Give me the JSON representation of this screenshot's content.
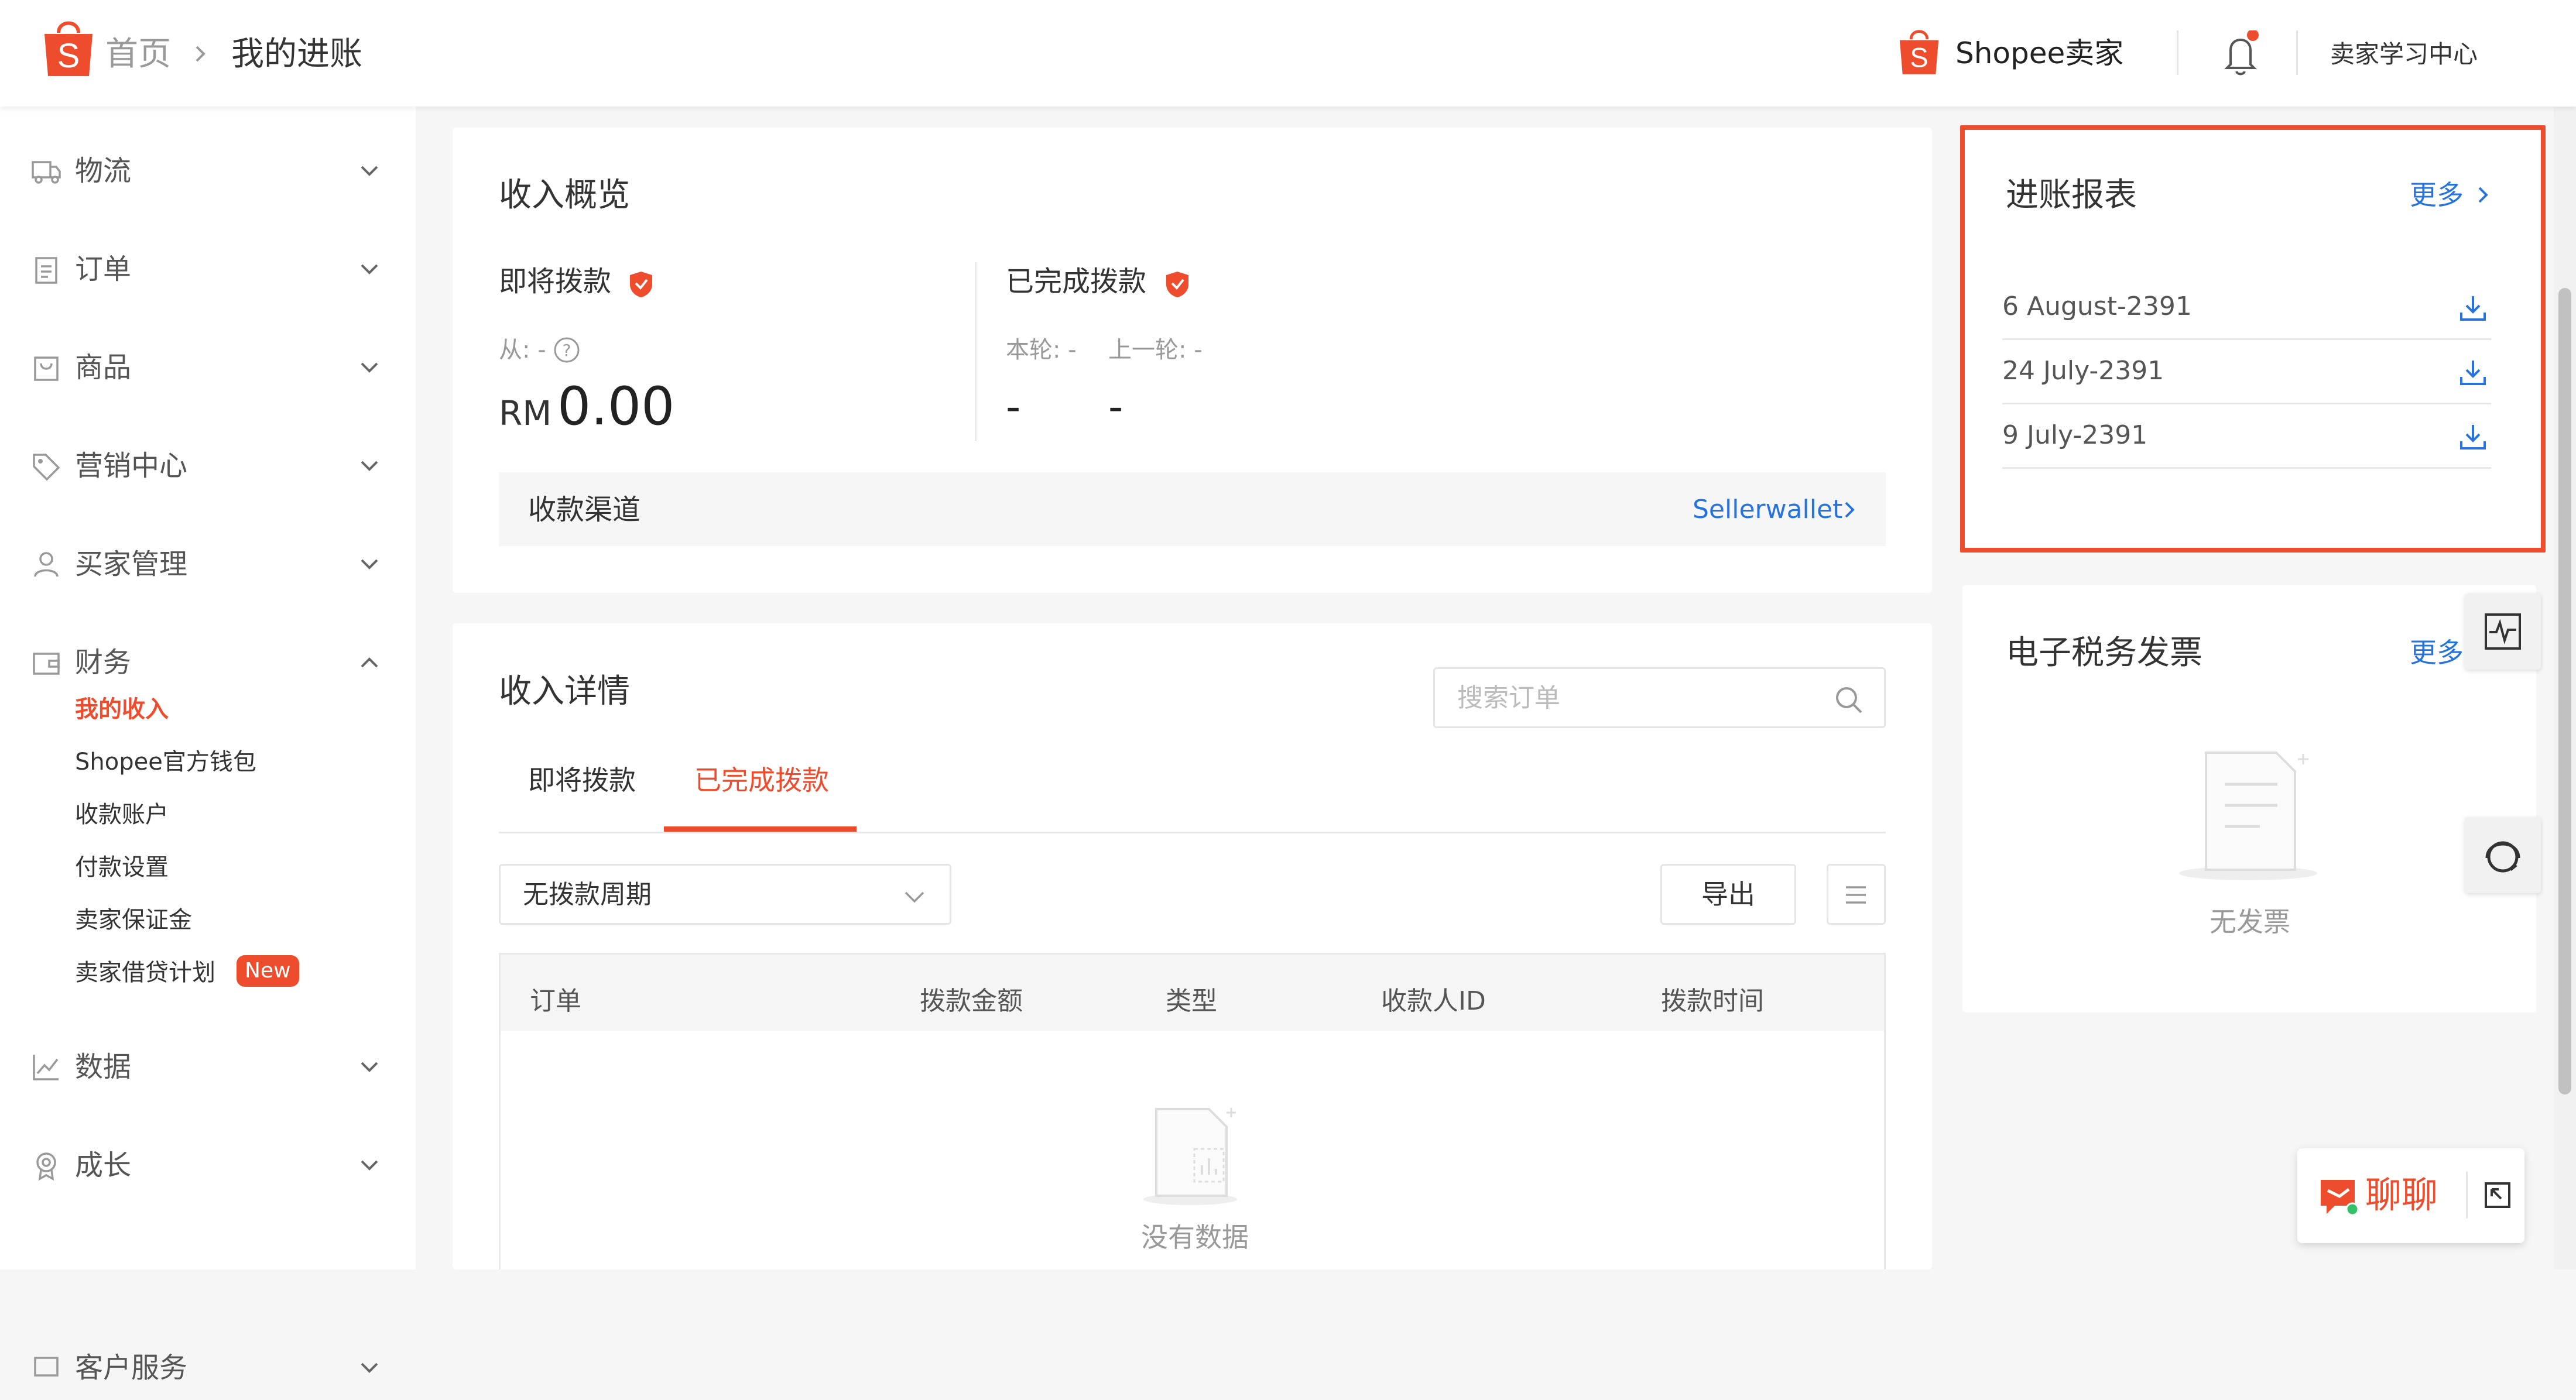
{
  "header": {
    "home": "首页",
    "current_page": "我的进账",
    "brand": "Shopee卖家",
    "learning_center": "卖家学习中心"
  },
  "sidebar": {
    "sections": [
      {
        "label": "物流",
        "icon": "truck-icon",
        "expanded": false
      },
      {
        "label": "订单",
        "icon": "clipboard-icon",
        "expanded": false
      },
      {
        "label": "商品",
        "icon": "bag-icon",
        "expanded": false
      },
      {
        "label": "营销中心",
        "icon": "tag-icon",
        "expanded": false
      },
      {
        "label": "买家管理",
        "icon": "user-icon",
        "expanded": false
      },
      {
        "label": "财务",
        "icon": "wallet-icon",
        "expanded": true
      },
      {
        "label": "数据",
        "icon": "chart-icon",
        "expanded": false
      },
      {
        "label": "成长",
        "icon": "medal-icon",
        "expanded": false
      },
      {
        "label": "客户服务",
        "icon": "service-icon",
        "expanded": false
      }
    ],
    "finance_items": [
      {
        "label": "我的收入",
        "active": true
      },
      {
        "label": "Shopee官方钱包",
        "active": false
      },
      {
        "label": "收款账户",
        "active": false
      },
      {
        "label": "付款设置",
        "active": false
      },
      {
        "label": "卖家保证金",
        "active": false
      },
      {
        "label": "卖家借贷计划",
        "active": false,
        "badge": "New"
      }
    ]
  },
  "overview": {
    "title": "收入概览",
    "upcoming": {
      "label": "即将拨款",
      "from": "从: -",
      "currency": "RM",
      "amount": "0.00"
    },
    "completed": {
      "label": "已完成拨款",
      "this_round_label": "本轮: -",
      "last_round_label": "上一轮: -",
      "this_round_value": "-",
      "last_round_value": "-"
    },
    "channel": {
      "label": "收款渠道",
      "link": "Sellerwallet"
    }
  },
  "details": {
    "title": "收入详情",
    "search_placeholder": "搜索订单",
    "tabs": [
      {
        "label": "即将拨款",
        "active": false
      },
      {
        "label": "已完成拨款",
        "active": true
      }
    ],
    "period_select": "无拨款周期",
    "export_button": "导出",
    "columns": [
      "订单",
      "拨款金额",
      "类型",
      "收款人ID",
      "拨款时间"
    ],
    "empty_text": "没有数据"
  },
  "reports": {
    "title": "进账报表",
    "more": "更多",
    "items": [
      {
        "date": "6 August-2391"
      },
      {
        "date": "24 July-2391"
      },
      {
        "date": "9 July-2391"
      }
    ],
    "highlight_color": "#ee4d2d"
  },
  "einvoice": {
    "title": "电子税务发票",
    "more": "更多",
    "empty_text": "无发票"
  },
  "chat": {
    "label": "聊聊"
  },
  "colors": {
    "brand": "#ee4d2d",
    "link": "#2673dd"
  }
}
